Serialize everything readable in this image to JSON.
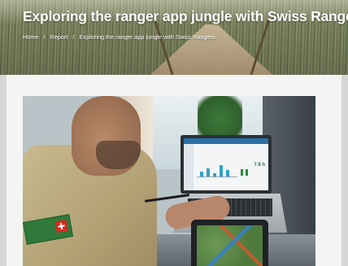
{
  "page": {
    "title": "Exploring the ranger app jungle with Swiss Rangers"
  },
  "breadcrumb": {
    "items": [
      {
        "label": "Home"
      },
      {
        "label": "Report"
      },
      {
        "label": "Exploring the ranger app jungle with Swiss Rangers"
      }
    ],
    "separator": "/"
  },
  "photo": {
    "laptop_value": "7.9 h"
  },
  "colors": {
    "title_text": "#ffffff",
    "page_bg": "#d6d6d6",
    "card_bg": "#f4f4f4"
  }
}
